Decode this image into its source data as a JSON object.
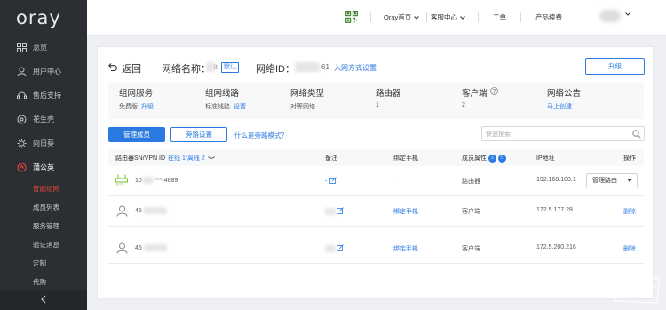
{
  "brand": {
    "logo": "oray"
  },
  "sidebar": {
    "items": [
      {
        "label": "总览",
        "icon": "grid-icon"
      },
      {
        "label": "用户中心",
        "icon": "user-icon"
      },
      {
        "label": "售后支持",
        "icon": "support-icon"
      },
      {
        "label": "花生壳",
        "icon": "peanut-icon"
      },
      {
        "label": "向日葵",
        "icon": "sunflower-icon"
      },
      {
        "label": "蒲公英",
        "icon": "dandelion-icon"
      }
    ],
    "sub_items": [
      "智能组网",
      "成员列表",
      "服务管理",
      "验证消息",
      "定制",
      "代购"
    ]
  },
  "topbar": {
    "oray_home": "Oray首页",
    "service_center": "客服中心",
    "ticket": "工单",
    "renew": "产品续费"
  },
  "header": {
    "back": "返回",
    "network_name_label": "网络名称：",
    "network_name_value": "it",
    "default_badge": "默认",
    "network_id_label": "网络ID：",
    "network_id_suffix": "61",
    "join_link": "入网方式设置",
    "upgrade": "升级"
  },
  "info": [
    {
      "title": "组网服务",
      "value": "免费版",
      "link": "升级"
    },
    {
      "title": "组网线路",
      "value": "标准线路",
      "link": "设置"
    },
    {
      "title": "网络类型",
      "value": "对等网络",
      "link": ""
    },
    {
      "title": "路由器",
      "value": "1",
      "link": ""
    },
    {
      "title": "客户端",
      "value": "2",
      "link": ""
    },
    {
      "title": "网络公告",
      "value": "",
      "link": "马上创建"
    }
  ],
  "actions": {
    "manage_members": "管理成员",
    "bypass_settings": "旁路设置",
    "what_is_bypass": "什么是旁路模式？",
    "search_placeholder": "快速搜索"
  },
  "table": {
    "headers": {
      "device_prefix": "路由器SN/VPN ID",
      "online": "在线 1",
      "separator": " / ",
      "offline": "离线 2",
      "note": "备注",
      "bind_phone": "绑定手机",
      "member_attr": "成员属性",
      "ip": "IP地址",
      "ops": "操作"
    },
    "rows": [
      {
        "id_prefix": "10",
        "id_suffix": "****4889",
        "note": "-",
        "phone": "-",
        "attr": "路由器",
        "ip": "192.168.100.1",
        "op": "管理路由"
      },
      {
        "id_prefix": "45",
        "id_suffix": "",
        "note": "",
        "phone": "绑定手机",
        "attr": "客户端",
        "ip": "172.5.177.28",
        "op": "删除"
      },
      {
        "id_prefix": "45",
        "id_suffix": "",
        "note": "",
        "phone": "绑定手机",
        "attr": "客户端",
        "ip": "172.5.200.216",
        "op": "删除"
      }
    ]
  },
  "colors": {
    "accent": "#2a7ae2",
    "brand_red": "#e0453a",
    "sidebar_bg": "#2b2e33"
  }
}
